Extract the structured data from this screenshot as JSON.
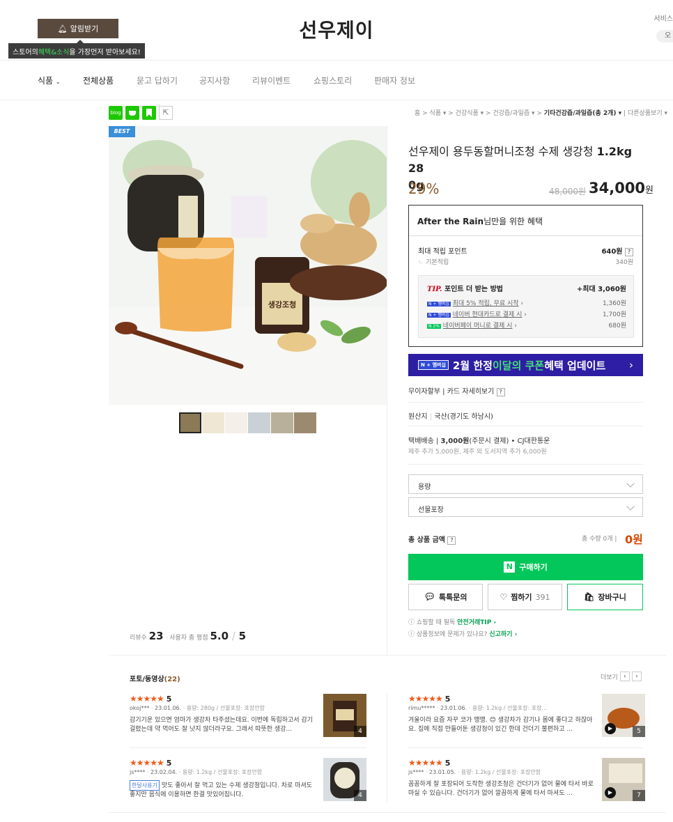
{
  "header": {
    "alarm_label": "알림받기",
    "tooltip_pre": "스토어의 ",
    "tooltip_hl": "혜택&소식",
    "tooltip_post": "을 가장먼저 받아보세요!",
    "store_name": "선우제이",
    "service_label": "서비스",
    "pill_label": "오"
  },
  "nav": {
    "items": [
      "식품",
      "전체상품",
      "묻고 답하기",
      "공지사항",
      "리뷰이벤트",
      "쇼핑스토리",
      "판매자 정보"
    ]
  },
  "breadcrumb": {
    "trail": "홈 > 식품 ▾ > 건강식품 ▾ > 건강즙/과일즙 ▾ > ",
    "current": "기타건강즙/과일즙(총 2개) ▾",
    "extra": "| 다른상품보기 ▾"
  },
  "product": {
    "badge": "BEST",
    "title_pre": "선우제이 용두동할머니조청 수제 생강청 ",
    "title_bold": "1.2kg 28",
    "title_tail": "0g",
    "discount": "29%",
    "original_price": "48,000원",
    "price": "34,000",
    "price_unit": "원"
  },
  "benefit": {
    "heading_user": "After the Rain",
    "heading_rest": "님만을 위한 혜택",
    "max_point_label": "최대 적립 포인트",
    "max_point_value": "640원",
    "base_label": "기본적립",
    "base_value": "340원",
    "tip_title": "TIP.",
    "tip_rest": " 포인트 더 받는 방법",
    "tip_max": "+최대 3,060원",
    "tips": [
      {
        "badge": "N + 멤버십",
        "text": "최대 5% 적립, 무료 시작",
        "value": "1,360원"
      },
      {
        "badge": "N + 멤버십",
        "text": "네이버 현대카드로 결제 시",
        "value": "1,700원"
      },
      {
        "badge": "N 2%",
        "text": "네이버페이 머니로 결제 시",
        "value": "680원"
      }
    ]
  },
  "coupon": {
    "badge": "N + 멤버십",
    "text_pre": "2월 한정 ",
    "text_hl": "이달의 쿠폰",
    "text_post": " 혜택 업데이트",
    "arrow": "›"
  },
  "info": {
    "installment": "무이자할부 | 카드 자세히보기",
    "origin_label": "원산지",
    "origin_value": "국산(경기도 하남시)",
    "ship_label": "택배배송 | ",
    "ship_price": "3,000원",
    "ship_rest": "(주문시 결제) • CJ대한통운",
    "ship_extra": "제주 추가 5,000원, 제주 외 도서지역 추가 6,000원"
  },
  "options": {
    "option1": "용량",
    "option2": "선물포장"
  },
  "total": {
    "label": "총 상품 금액",
    "qty": "총 수량 0개 |",
    "amount": "0원"
  },
  "actions": {
    "buy": "구매하기",
    "talk": "톡톡문의",
    "wish": "찜하기",
    "wish_count": "391",
    "cart": "장바구니"
  },
  "notes": {
    "n1_pre": "쇼핑할 때 필독 ",
    "n1_link": "안전거래TIP ›",
    "n2_pre": "상품정보에 문제가 있나요? ",
    "n2_link": "신고하기 ›"
  },
  "review_summary": {
    "count_label": "리뷰수",
    "count": "23",
    "rating_label": "사용자 총 평점",
    "rating": "5.0",
    "rating_max": "5"
  },
  "photo_reviews": {
    "title": "포토/동영상",
    "count": "(22)",
    "more": "더보기",
    "items": [
      {
        "rating": "5",
        "user": "okoj***",
        "date": "23.01.06.",
        "option": "용량: 280g / 선물포장: 포장안함",
        "badge": "",
        "text": "감기기운 있으면 엄마가 생강차 타주셨는데요. 이번에 독립하고서 감기 걸렸는데 약 먹어도 잘 낫지 않더라구요. 그래서 따뜻한 생강...",
        "count": "4"
      },
      {
        "rating": "5",
        "user": "rimu*****",
        "date": "23.01.06.",
        "option": "용량: 1.2kg / 선물포장: 포장...",
        "badge": "",
        "text": "겨울이라 요즘 자꾸 코가 맹맹. 😊 생강차가 감기나 몸에 좋다고 하잖아요. 집에 직접 만들어둔 생강청이 있긴 한데 건더기 불편하고 ...",
        "count": "5"
      },
      {
        "rating": "5",
        "user": "js****",
        "date": "23.02.04.",
        "option": "용량: 1.2kg / 선물포장: 포장안함",
        "badge": "한달사용기",
        "text": "맛도 좋아서 잘 먹고 있는 수제 생강청입니다. 차로 마셔도 좋지만 음식에 이용하면 한결 맛있어집니다.",
        "count": "4"
      },
      {
        "rating": "5",
        "user": "js****",
        "date": "23.01.05.",
        "option": "용량: 1.2kg / 선물포장: 포장안함",
        "badge": "",
        "text": "꼼꼼하게 잘 포장되어 도착한 생강조청은 건더기가 없어 물에 타서 바로 마실 수 있습니다. 건더기가 없어 깔끔하게 물에 타서 마셔도 ...",
        "count": "7"
      }
    ]
  }
}
